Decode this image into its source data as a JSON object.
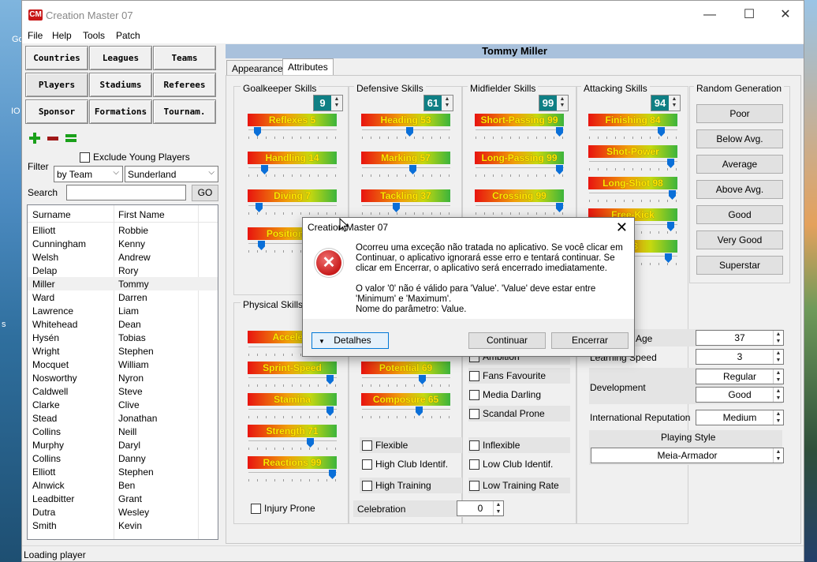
{
  "window": {
    "title": "Creation Master 07",
    "logo": "CM",
    "minimize_icon": "—",
    "maximize_icon": "☐",
    "close_icon": "✕"
  },
  "menu": [
    "File",
    "Help",
    "Tools",
    "Patch"
  ],
  "nav_buttons": [
    "Countries",
    "Leagues",
    "Teams",
    "Players",
    "Stadiums",
    "Referees",
    "Sponsor",
    "Formations",
    "Tournam."
  ],
  "filters": {
    "exclude_young_label": "Exclude Young Players",
    "filter_label": "Filter",
    "filter_by": "by Team",
    "filter_team": "Sunderland",
    "search_label": "Search",
    "search_value": "",
    "go_label": "GO"
  },
  "player_list": {
    "columns": [
      "Surname",
      "First Name"
    ],
    "rows": [
      [
        "Elliott",
        "Robbie"
      ],
      [
        "Cunningham",
        "Kenny"
      ],
      [
        "Welsh",
        "Andrew"
      ],
      [
        "Delap",
        "Rory"
      ],
      [
        "Miller",
        "Tommy"
      ],
      [
        "Ward",
        "Darren"
      ],
      [
        "Lawrence",
        "Liam"
      ],
      [
        "Whitehead",
        "Dean"
      ],
      [
        "Hysén",
        "Tobias"
      ],
      [
        "Wright",
        "Stephen"
      ],
      [
        "Mocquet",
        "William"
      ],
      [
        "Nosworthy",
        "Nyron"
      ],
      [
        "Caldwell",
        "Steve"
      ],
      [
        "Clarke",
        "Clive"
      ],
      [
        "Stead",
        "Jonathan"
      ],
      [
        "Collins",
        "Neill"
      ],
      [
        "Murphy",
        "Daryl"
      ],
      [
        "Collins",
        "Danny"
      ],
      [
        "Elliott",
        "Stephen"
      ],
      [
        "Alnwick",
        "Ben"
      ],
      [
        "Leadbitter",
        "Grant"
      ],
      [
        "Dutra",
        "Wesley"
      ],
      [
        "Smith",
        "Kevin"
      ]
    ],
    "selected": "Miller"
  },
  "player_name": "Tommy Miller",
  "tabs": [
    "Appearance",
    "Attributes"
  ],
  "active_tab": "Attributes",
  "skill_groups": {
    "goalkeeper": {
      "title": "Goalkeeper Skills",
      "avg": "9"
    },
    "defensive": {
      "title": "Defensive Skills",
      "avg": "61"
    },
    "midfielder": {
      "title": "Midfielder Skills",
      "avg": "99"
    },
    "attacking": {
      "title": "Attacking Skills",
      "avg": "94"
    },
    "random": {
      "title": "Random Generation"
    },
    "physical": {
      "title": "Physical Skills"
    }
  },
  "skills": {
    "reflexes": {
      "label": "Reflexes 5",
      "value": 5
    },
    "handling": {
      "label": "Handling 14",
      "value": 14
    },
    "diving": {
      "label": "Diving 7",
      "value": 7
    },
    "positioning": {
      "label": "Positioning",
      "value": 10
    },
    "heading": {
      "label": "Heading 53",
      "value": 53
    },
    "marking": {
      "label": "Marking 57",
      "value": 57
    },
    "tackling": {
      "label": "Tackling 37",
      "value": 37
    },
    "short_passing": {
      "label": "Short-Passing 99",
      "value": 99
    },
    "long_passing": {
      "label": "Long-Passing 99",
      "value": 99
    },
    "crossing": {
      "label": "Crossing 99",
      "value": 99
    },
    "finishing": {
      "label": "Finishing 84",
      "value": 84
    },
    "shot_power": {
      "label": "Shot-Power",
      "value": 96
    },
    "long_shot": {
      "label": "Long-Shot 98",
      "value": 98
    },
    "free_kick": {
      "label": "Free-Kick",
      "value": 96
    },
    "attacking_extra": {
      "label": "93",
      "value": 93
    },
    "acceleration": {
      "label": "Accelera",
      "value": 90
    },
    "sprint_speed": {
      "label": "Sprint-Speed",
      "value": 96
    },
    "stamina": {
      "label": "Stamina",
      "value": 96
    },
    "strength": {
      "label": "Strength 71",
      "value": 71
    },
    "reactions": {
      "label": "Reactions 99",
      "value": 99
    },
    "potential": {
      "label": "Potential 69",
      "value": 69
    },
    "composure": {
      "label": "Composure 65",
      "value": 65
    }
  },
  "random_buttons": [
    "Poor",
    "Below Avg.",
    "Average",
    "Above Avg.",
    "Good",
    "Very Good",
    "Superstar"
  ],
  "traits_left": [
    "Flexible",
    "High Club Identif.",
    "High Training"
  ],
  "traits_right": [
    "Ambition",
    "Fans Favourite",
    "Media Darling",
    "Scandal Prone",
    "Inflexible",
    "Low Club Identif.",
    "Low Training Rate"
  ],
  "injury_prone_label": "Injury Prone",
  "celebration": {
    "label": "Celebration",
    "value": "0"
  },
  "profile": {
    "age_label": "Age",
    "age": "37",
    "learning_label": "Learning Speed",
    "learning": "3",
    "development_label": "Development",
    "development_1": "Regular",
    "development_2": "Good",
    "reputation_label": "International Reputation",
    "reputation": "Medium",
    "style_label": "Playing Style",
    "style": "Meia-Armador"
  },
  "status": "Loading player",
  "dialog": {
    "title": "Creation Master 07",
    "close_icon": "✕",
    "error_icon": "✕",
    "message_1": "Ocorreu uma exceção não tratada no aplicativo. Se você clicar em Continuar, o aplicativo ignorará esse erro e tentará continuar. Se clicar em Encerrar, o aplicativo será encerrado imediatamente.",
    "message_2": "O valor '0' não é válido para 'Value'. 'Value' deve estar entre 'Minimum' e 'Maximum'.",
    "message_3": "Nome do parâmetro: Value.",
    "details_label": "Detalhes",
    "details_icon": "▼",
    "continue_label": "Continuar",
    "exit_label": "Encerrar"
  },
  "desktop_fragments": [
    "Go",
    "IO",
    "s"
  ]
}
